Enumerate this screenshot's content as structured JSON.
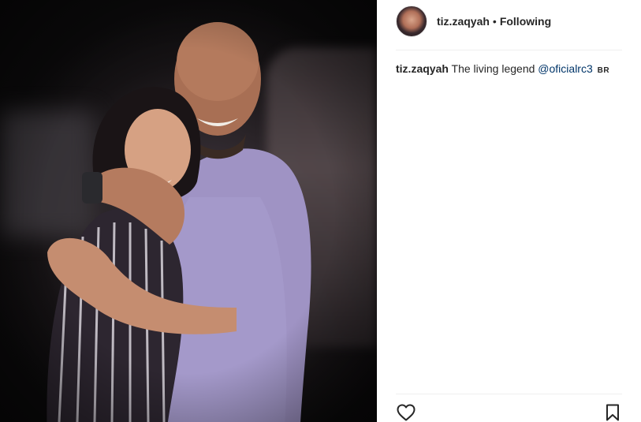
{
  "post": {
    "photo_alt": "Photo",
    "author": {
      "username": "tiz.zaqyah",
      "separator": "•",
      "follow_status": "Following"
    },
    "caption": {
      "username": "tiz.zaqyah",
      "text": "The living legend",
      "mention": "@oficialrc3",
      "badge": "BR"
    },
    "actions": {
      "like_icon": "heart-icon",
      "save_icon": "bookmark-icon"
    }
  },
  "colors": {
    "text": "#262626",
    "mention": "#003569",
    "divider": "#efefef"
  }
}
